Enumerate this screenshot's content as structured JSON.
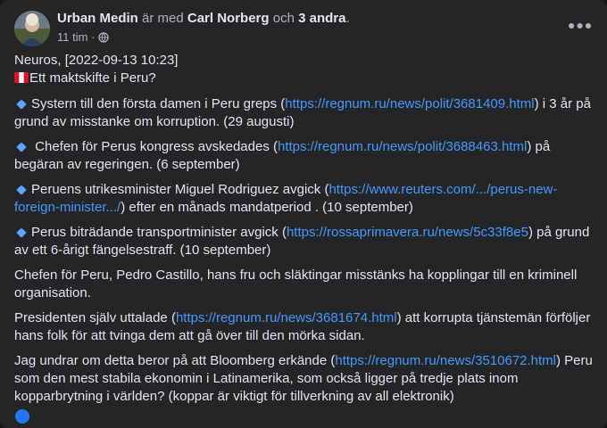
{
  "post": {
    "author": "Urban Medin",
    "with_text": "är med",
    "tagged_name": "Carl Norberg",
    "and_text": "och",
    "others": "3 andra",
    "period": ".",
    "time": "11 tim",
    "separator": "·",
    "more_icon": "more-horizontal-icon",
    "privacy_icon": "globe-icon"
  },
  "content": {
    "line1": "Neuros, [2022-09-13 10:23]",
    "line2": "Ett maktskifte i Peru?",
    "b1_pre": "Systern till den första damen i Peru greps (",
    "b1_link": "https://regnum.ru/news/polit/3681409.html",
    "b1_post": ") i 3 år på grund av misstanke om korruption. (29 augusti)",
    "b2_pre": " Chefen för Perus kongress avskedades (",
    "b2_link": "https://regnum.ru/news/polit/3688463.html",
    "b2_post": ") på begäran av regeringen. (6 september)",
    "b3_pre": "Peruens utrikesminister Miguel Rodriguez avgick (",
    "b3_link": "https://www.reuters.com/.../perus-new-foreign-minister.../",
    "b3_post": ") efter en månads mandatperiod . (10 september)",
    "b4_pre": "Perus biträdande transportminister avgick (",
    "b4_link": "https://rossaprimavera.ru/news/5c33f8e5",
    "b4_post": ") på grund av ett 6-årigt fängelsestraff. (10 september)",
    "p1": "Chefen för Peru, Pedro Castillo, hans fru och släktingar misstänks ha kopplingar till en kriminell organisation.",
    "p2_pre": "Presidenten själv uttalade (",
    "p2_link": "https://regnum.ru/news/3681674.html",
    "p2_post": ") att korrupta tjänstemän förföljer hans folk för att tvinga dem att gå över till den mörka sidan.",
    "p3_pre": "Jag undrar om detta beror på att Bloomberg erkände (",
    "p3_link": "https://regnum.ru/news/3510672.html",
    "p3_post": ") Peru som den mest stabila ekonomin i Latinamerika, som också ligger på tredje plats inom kopparbrytning i världen? (koppar är viktigt för tillverkning av all elektronik)"
  },
  "colors": {
    "card_bg": "#242526",
    "text": "#e4e6eb",
    "secondary_text": "#b0b3b8",
    "link": "#4599ff",
    "bullet": "#5aa6ff"
  }
}
